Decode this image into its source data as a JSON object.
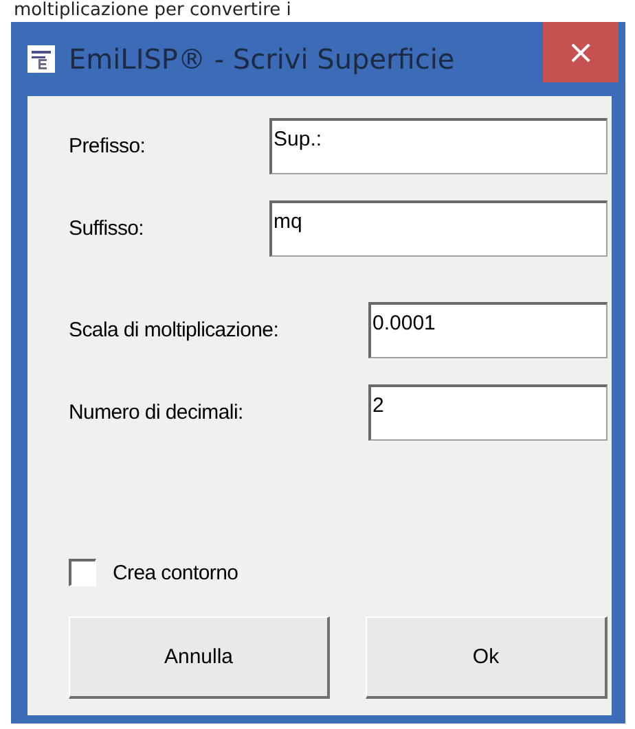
{
  "background_text": "moltiplicazione per convertire i",
  "window": {
    "title": "EmiLISP® - Scrivi Superficie",
    "close": "×"
  },
  "sections": [
    {
      "fields": [
        {
          "label": "Prefisso:",
          "value": "Sup.:"
        },
        {
          "label": "Suffisso:",
          "value": "mq"
        }
      ]
    },
    {
      "fields": [
        {
          "label": "Scala di moltiplicazione:",
          "value": "0.0001"
        },
        {
          "label": "Numero di decimali:",
          "value": "2"
        }
      ]
    }
  ],
  "checkbox": {
    "label": "Crea contorno",
    "checked": false
  },
  "buttons": [
    "Annulla",
    "Ok"
  ]
}
